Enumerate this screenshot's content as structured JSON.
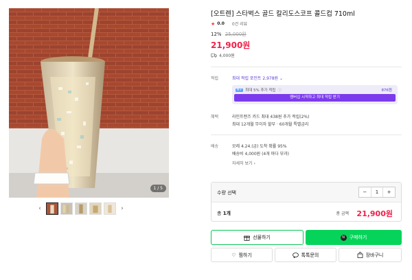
{
  "gallery": {
    "page_indicator": "1 / 5",
    "prev_arrow": "‹",
    "next_arrow": "›"
  },
  "product": {
    "title": "[오트렌] 스타벅스 골드 칼리도스코프 콜드컵 710ml",
    "rating": "0.0",
    "review_count": "0건 리뷰",
    "discount_rate": "12%",
    "original_price": "25,000원",
    "price": "21,900원",
    "delivery_fee": "4,000원"
  },
  "points": {
    "label": "적립",
    "max_points_text": "최대 적립 포인트 2,978원",
    "membership_badge": "N+",
    "membership_text": "최대 5% 추가 적립",
    "membership_amount": "876원",
    "membership_button": "멤버십 시작하고 최대 적립 받기"
  },
  "benefits": {
    "label": "혜택",
    "line1": "라인프렌즈 카드 최대 438원 추가 적립(2%)",
    "line2": "최대 12개월 무이자 할부 · 60개월 특별금리"
  },
  "shipping": {
    "label": "배송",
    "line1": "모레 4.24.(금) 도착 확률 95%",
    "line2": "배송비 4,000원 (4개 마다 부과)",
    "details_link": "자세히 보기"
  },
  "order": {
    "quantity_label": "수량 선택",
    "minus": "−",
    "quantity": "1",
    "plus": "+",
    "total_count_prefix": "총",
    "total_count_value": "1개",
    "total_label": "총 금액",
    "total_price": "21,900원"
  },
  "actions": {
    "gift": "선물하기",
    "buy_icon": "N",
    "buy": "구매하기",
    "wish": "찜하기",
    "talk": "톡톡문의",
    "cart": "장바구니"
  },
  "colors": {
    "price_red": "#f0224b",
    "naver_green": "#06d45a",
    "membership_purple": "#7c3aed"
  }
}
